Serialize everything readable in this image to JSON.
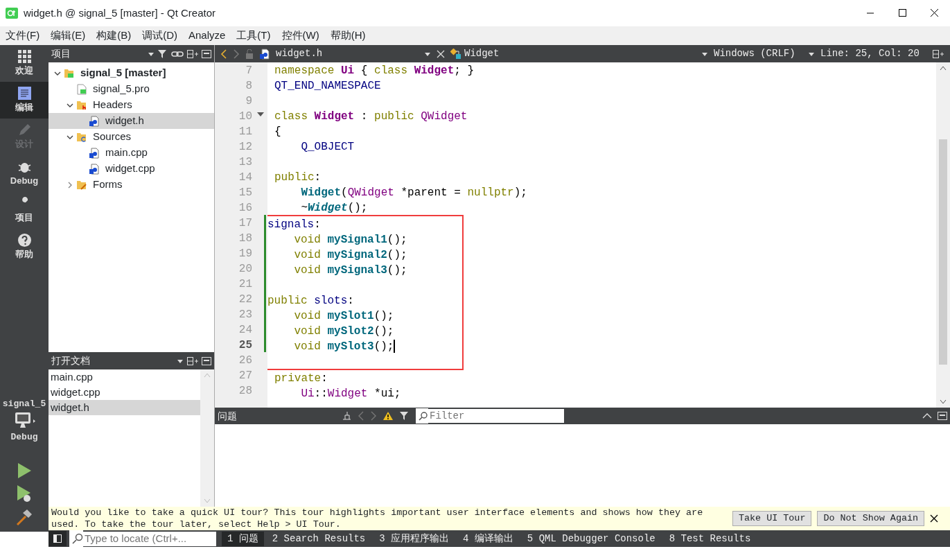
{
  "window": {
    "title": "widget.h @ signal_5 [master] - Qt Creator"
  },
  "menu": [
    "文件(F)",
    "编辑(E)",
    "构建(B)",
    "调试(D)",
    "Analyze",
    "工具(T)",
    "控件(W)",
    "帮助(H)"
  ],
  "mode_bar": {
    "items": [
      {
        "label": "欢迎",
        "kind": "welcome",
        "selected": false,
        "disabled": false
      },
      {
        "label": "编辑",
        "kind": "edit",
        "selected": true,
        "disabled": false
      },
      {
        "label": "设计",
        "kind": "design",
        "selected": false,
        "disabled": true
      },
      {
        "label": "Debug",
        "kind": "debug",
        "selected": false,
        "disabled": false
      },
      {
        "label": "项目",
        "kind": "projects",
        "selected": false,
        "disabled": false
      },
      {
        "label": "帮助",
        "kind": "help",
        "selected": false,
        "disabled": false
      }
    ],
    "kit": {
      "project": "signal_5",
      "build": "Debug"
    }
  },
  "projects_pane": {
    "title": "项目",
    "tree": [
      {
        "label": "signal_5 [master]",
        "kind": "project",
        "expanded": true,
        "selected": false,
        "children": [
          {
            "label": "signal_5.pro",
            "kind": "pro",
            "selected": false
          },
          {
            "label": "Headers",
            "kind": "headers",
            "expanded": true,
            "selected": false,
            "children": [
              {
                "label": "widget.h",
                "kind": "file",
                "selected": true
              }
            ]
          },
          {
            "label": "Sources",
            "kind": "sources",
            "expanded": true,
            "selected": false,
            "children": [
              {
                "label": "main.cpp",
                "kind": "file",
                "selected": false
              },
              {
                "label": "widget.cpp",
                "kind": "file",
                "selected": false
              }
            ]
          },
          {
            "label": "Forms",
            "kind": "forms",
            "expanded": false,
            "selected": false
          }
        ]
      }
    ]
  },
  "open_documents": {
    "title": "打开文档",
    "items": [
      {
        "label": "main.cpp",
        "selected": false
      },
      {
        "label": "widget.cpp",
        "selected": false
      },
      {
        "label": "widget.h",
        "selected": true
      }
    ]
  },
  "editor_toolbar": {
    "file": "widget.h",
    "symbol": "Widget",
    "line_ending": "Windows (CRLF)",
    "position": "Line: 25, Col: 20"
  },
  "editor": {
    "blocks": [
      {
        "boxed": false,
        "lines": [
          {
            "number": "7",
            "current": false,
            "modified": false,
            "fold": false,
            "indented": false,
            "tokens": [
              {
                "text": "namespace ",
                "kind": "keyword"
              },
              {
                "text": "Ui",
                "kind": "class-decl"
              },
              {
                "text": " { ",
                "kind": "plain"
              },
              {
                "text": "class ",
                "kind": "keyword"
              },
              {
                "text": "Widget",
                "kind": "class-decl"
              },
              {
                "text": "; }",
                "kind": "plain"
              }
            ]
          },
          {
            "number": "8",
            "current": false,
            "modified": false,
            "fold": false,
            "indented": false,
            "tokens": [
              {
                "text": "QT_END_NAMESPACE",
                "kind": "macro"
              }
            ]
          },
          {
            "number": "9",
            "current": false,
            "modified": false,
            "fold": false
          },
          {
            "number": "10",
            "current": false,
            "modified": false,
            "fold": true,
            "indented": false,
            "tokens": [
              {
                "text": "class ",
                "kind": "keyword"
              },
              {
                "text": "Widget",
                "kind": "class-decl"
              },
              {
                "text": " : ",
                "kind": "plain"
              },
              {
                "text": "public ",
                "kind": "keyword"
              },
              {
                "text": "QWidget",
                "kind": "type"
              }
            ]
          },
          {
            "number": "11",
            "current": false,
            "modified": false,
            "fold": false,
            "indented": false,
            "tokens": [
              {
                "text": "{",
                "kind": "plain"
              }
            ]
          },
          {
            "number": "12",
            "current": false,
            "modified": false,
            "fold": false,
            "indented": true,
            "tokens": [
              {
                "text": "Q_OBJECT",
                "kind": "macro"
              }
            ]
          },
          {
            "number": "13",
            "current": false,
            "modified": false,
            "fold": false
          },
          {
            "number": "14",
            "current": false,
            "modified": false,
            "fold": false,
            "indented": false,
            "tokens": [
              {
                "text": "public",
                "kind": "keyword"
              },
              {
                "text": ":",
                "kind": "plain"
              }
            ]
          },
          {
            "number": "15",
            "current": false,
            "modified": false,
            "fold": false,
            "indented": true,
            "tokens": [
              {
                "text": "Widget",
                "kind": "func"
              },
              {
                "text": "(",
                "kind": "plain"
              },
              {
                "text": "QWidget",
                "kind": "type"
              },
              {
                "text": " *parent = ",
                "kind": "plain"
              },
              {
                "text": "nullptr",
                "kind": "keyword"
              },
              {
                "text": ");",
                "kind": "plain"
              }
            ]
          },
          {
            "number": "16",
            "current": false,
            "modified": false,
            "fold": false,
            "indented": true,
            "tokens": [
              {
                "text": "~",
                "kind": "plain"
              },
              {
                "text": "Widget",
                "kind": "dtor"
              },
              {
                "text": "();",
                "kind": "plain"
              }
            ]
          }
        ]
      },
      {
        "boxed": true,
        "lines": [
          {
            "number": "17",
            "current": false,
            "modified": true,
            "fold": false,
            "indented": false,
            "tokens": [
              {
                "text": "signals",
                "kind": "macro"
              },
              {
                "text": ":",
                "kind": "plain"
              }
            ]
          },
          {
            "number": "18",
            "current": false,
            "modified": true,
            "fold": false,
            "indented": true,
            "tokens": [
              {
                "text": "void ",
                "kind": "keyword"
              },
              {
                "text": "mySignal1",
                "kind": "func"
              },
              {
                "text": "();",
                "kind": "plain"
              }
            ]
          },
          {
            "number": "19",
            "current": false,
            "modified": true,
            "fold": false,
            "indented": true,
            "tokens": [
              {
                "text": "void ",
                "kind": "keyword"
              },
              {
                "text": "mySignal2",
                "kind": "func"
              },
              {
                "text": "();",
                "kind": "plain"
              }
            ]
          },
          {
            "number": "20",
            "current": false,
            "modified": true,
            "fold": false,
            "indented": true,
            "tokens": [
              {
                "text": "void ",
                "kind": "keyword"
              },
              {
                "text": "mySignal3",
                "kind": "func"
              },
              {
                "text": "();",
                "kind": "plain"
              }
            ]
          },
          {
            "number": "21",
            "current": false,
            "modified": true,
            "fold": false
          },
          {
            "number": "22",
            "current": false,
            "modified": true,
            "fold": false,
            "indented": false,
            "tokens": [
              {
                "text": "public ",
                "kind": "keyword"
              },
              {
                "text": "slots",
                "kind": "macro"
              },
              {
                "text": ":",
                "kind": "plain"
              }
            ]
          },
          {
            "number": "23",
            "current": false,
            "modified": true,
            "fold": false,
            "indented": true,
            "tokens": [
              {
                "text": "void ",
                "kind": "keyword"
              },
              {
                "text": "mySlot1",
                "kind": "func"
              },
              {
                "text": "();",
                "kind": "plain"
              }
            ]
          },
          {
            "number": "24",
            "current": false,
            "modified": true,
            "fold": false,
            "indented": true,
            "tokens": [
              {
                "text": "void ",
                "kind": "keyword"
              },
              {
                "text": "mySlot2",
                "kind": "func"
              },
              {
                "text": "();",
                "kind": "plain"
              }
            ]
          },
          {
            "number": "25",
            "current": true,
            "modified": true,
            "fold": false,
            "indented": true,
            "tokens": [
              {
                "text": "void ",
                "kind": "keyword"
              },
              {
                "text": "mySlot3",
                "kind": "func"
              },
              {
                "text": "();",
                "kind": "plain"
              }
            ]
          },
          {
            "number": "26",
            "current": false,
            "modified": false,
            "fold": false
          }
        ]
      },
      {
        "boxed": false,
        "lines": [
          {
            "number": "27",
            "current": false,
            "modified": false,
            "fold": false,
            "indented": false,
            "tokens": [
              {
                "text": "private",
                "kind": "keyword"
              },
              {
                "text": ":",
                "kind": "plain"
              }
            ]
          },
          {
            "number": "28",
            "current": false,
            "modified": false,
            "fold": false,
            "indented": true,
            "tokens": [
              {
                "text": "Ui",
                "kind": "type"
              },
              {
                "text": "::",
                "kind": "plain"
              },
              {
                "text": "Widget",
                "kind": "type"
              },
              {
                "text": " *ui;",
                "kind": "plain"
              }
            ]
          }
        ]
      }
    ]
  },
  "issues_pane": {
    "title": "问题",
    "filter_placeholder": "Filter"
  },
  "tour_bar": {
    "message": "Would you like to take a quick UI tour? This tour highlights important user interface elements and shows how they are used. To take the tour later, select Help > UI Tour.",
    "buttons": [
      "Take UI Tour",
      "Do Not Show Again"
    ]
  },
  "status_bar": {
    "locator_placeholder": "Type to locate (Ctrl+...",
    "tabs": [
      {
        "label": "1 问题",
        "selected": true
      },
      {
        "label": "2 Search Results",
        "selected": false
      },
      {
        "label": "3 应用程序输出",
        "selected": false
      },
      {
        "label": "4 编译输出",
        "selected": false
      },
      {
        "label": "5 QML Debugger Console",
        "selected": false
      },
      {
        "label": "8 Test Results",
        "selected": false
      }
    ]
  }
}
